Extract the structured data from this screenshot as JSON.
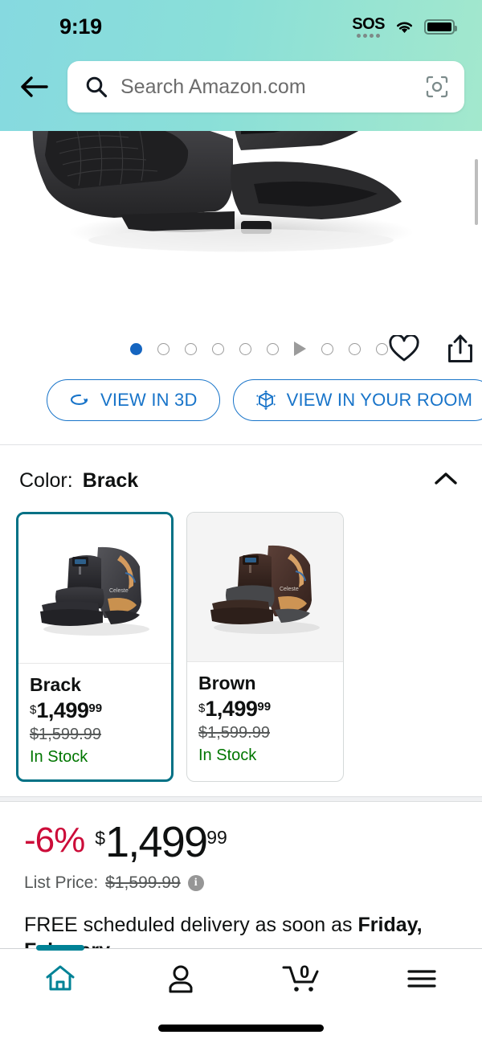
{
  "status_bar": {
    "time": "9:19",
    "sos_label": "SOS",
    "wifi_icon": "wifi-icon",
    "battery_icon": "battery-full-icon"
  },
  "header": {
    "back_icon": "back-arrow-icon",
    "search": {
      "placeholder": "Search Amazon.com",
      "value": "",
      "search_icon": "search-icon",
      "camera_icon": "camera-scan-icon"
    }
  },
  "gallery": {
    "product_alt": "Black massage chair",
    "dots": [
      {
        "type": "dot",
        "active": true
      },
      {
        "type": "dot",
        "active": false
      },
      {
        "type": "dot",
        "active": false
      },
      {
        "type": "dot",
        "active": false
      },
      {
        "type": "dot",
        "active": false
      },
      {
        "type": "dot",
        "active": false
      },
      {
        "type": "play",
        "active": false
      },
      {
        "type": "dot",
        "active": false
      },
      {
        "type": "dot",
        "active": false
      },
      {
        "type": "dot",
        "active": false
      }
    ],
    "wishlist_icon": "heart-icon",
    "share_icon": "share-icon",
    "view_3d_label": "VIEW IN 3D",
    "view_3d_icon": "rotate-3d-icon",
    "view_room_label": "VIEW IN YOUR ROOM",
    "view_room_icon": "ar-cube-icon"
  },
  "color_section": {
    "label": "Color:",
    "selected": "Brack",
    "collapse_icon": "chevron-up-icon",
    "variants": [
      {
        "name": "Brack",
        "currency": "$",
        "price_whole": "1,499",
        "price_frac": "99",
        "list_price": "$1,599.99",
        "availability": "In Stock",
        "selected": true
      },
      {
        "name": "Brown",
        "currency": "$",
        "price_whole": "1,499",
        "price_frac": "99",
        "list_price": "$1,599.99",
        "availability": "In Stock",
        "selected": false
      }
    ]
  },
  "price_block": {
    "discount": "-6%",
    "currency": "$",
    "price_whole": "1,499",
    "price_frac": "99",
    "list_price_label": "List Price:",
    "list_price_value": "$1,599.99",
    "info_icon": "info-icon",
    "info_glyph": "i",
    "delivery_prefix": "FREE scheduled delivery as soon as ",
    "delivery_date": "Friday, February"
  },
  "bottom_nav": {
    "items": [
      {
        "name": "home",
        "icon": "home-icon",
        "active": true
      },
      {
        "name": "account",
        "icon": "person-icon",
        "active": false
      },
      {
        "name": "cart",
        "icon": "cart-icon",
        "active": false,
        "badge": "0"
      },
      {
        "name": "menu",
        "icon": "hamburger-menu-icon",
        "active": false
      }
    ]
  },
  "colors": {
    "header_gradient_start": "#86d9e0",
    "header_gradient_end": "#a3e8cd",
    "accent_teal": "#007185",
    "link_blue": "#1874c9",
    "price_red": "#CC0C39",
    "stock_green": "#007600",
    "dot_active_blue": "#1565c0"
  }
}
